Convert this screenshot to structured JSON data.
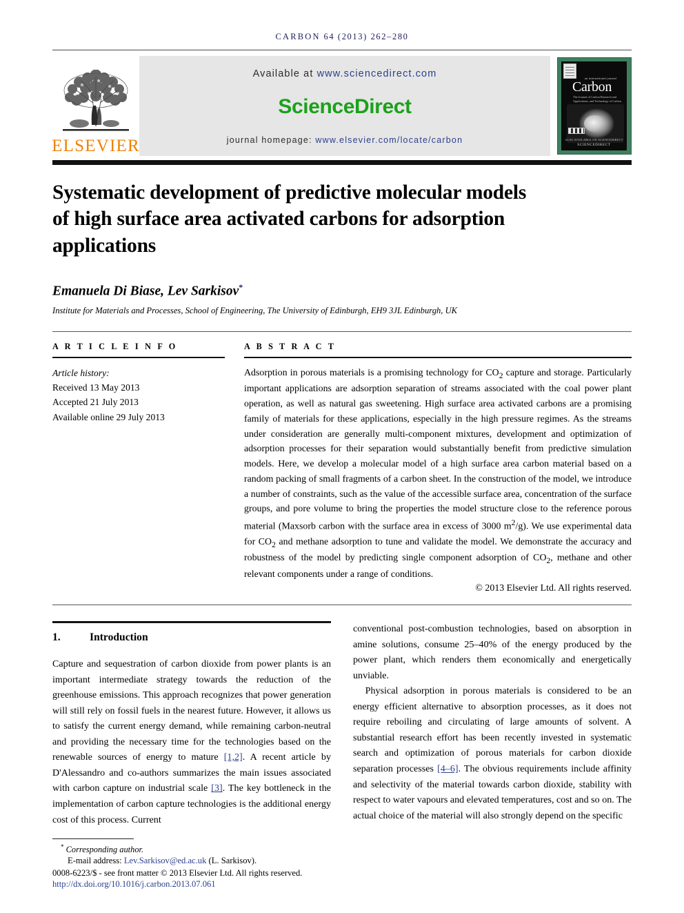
{
  "running_head": {
    "journal": "CARBON",
    "citation": "64 (2013) 262–280"
  },
  "masthead": {
    "publisher_logo_text": "ELSEVIER",
    "available_prefix": "Available at ",
    "available_url": "www.sciencedirect.com",
    "sciencedirect_logo": "ScienceDirect",
    "homepage_prefix": "journal homepage: ",
    "homepage_url": "www.elsevier.com/locate/carbon",
    "cover": {
      "kicker": "an international journal",
      "title": "Carbon",
      "subtitle": "The Journal of Carbon Research and Applications, and Technology of Carbon as an Element and Material",
      "footer_line1": "ALSO AVAILABLE ON SCIENCEDIRECT",
      "footer_line2": "SCIENCEDIRECT"
    },
    "colors": {
      "elsevier_orange": "#F08000",
      "sciencedirect_green": "#1BA11B",
      "cover_green": "#3F7F5F",
      "link_blue": "#2B3F8C",
      "banner_gray": "#E6E6E6"
    }
  },
  "article": {
    "title": "Systematic development of predictive molecular models of high surface area activated carbons for adsorption applications",
    "authors": "Emanuela Di Biase, Lev Sarkisov",
    "corresponding_marker": "*",
    "affiliation": "Institute for Materials and Processes, School of Engineering, The University of Edinburgh, EH9 3JL Edinburgh, UK"
  },
  "article_info": {
    "heading": "A R T I C L E   I N F O",
    "history_label": "Article history:",
    "received": "Received 13 May 2013",
    "accepted": "Accepted 21 July 2013",
    "available_online": "Available online 29 July 2013"
  },
  "abstract": {
    "heading": "A B S T R A C T",
    "text": "Adsorption in porous materials is a promising technology for CO2 capture and storage. Particularly important applications are adsorption separation of streams associated with the coal power plant operation, as well as natural gas sweetening. High surface area activated carbons are a promising family of materials for these applications, especially in the high pressure regimes. As the streams under consideration are generally multi-component mixtures, development and optimization of adsorption processes for their separation would substantially benefit from predictive simulation models. Here, we develop a molecular model of a high surface area carbon material based on a random packing of small fragments of a carbon sheet. In the construction of the model, we introduce a number of constraints, such as the value of the accessible surface area, concentration of the surface groups, and pore volume to bring the properties the model structure close to the reference porous material (Maxsorb carbon with the surface area in excess of 3000 m2/g). We use experimental data for CO2 and methane adsorption to tune and validate the model. We demonstrate the accuracy and robustness of the model by predicting single component adsorption of CO2, methane and other relevant components under a range of conditions.",
    "copyright": "© 2013 Elsevier Ltd. All rights reserved."
  },
  "section": {
    "number": "1.",
    "title": "Introduction"
  },
  "body": {
    "left_para_1_a": "Capture and sequestration of carbon dioxide from power plants is an important intermediate strategy towards the reduction of the greenhouse emissions. This approach recognizes that power generation will still rely on fossil fuels in the nearest future. However, it allows us to satisfy the current energy demand, while remaining carbon-neutral and providing the necessary time for the technologies based on the renewable sources of energy to mature ",
    "left_cite_1": "[1,2]",
    "left_para_1_b": ". A recent article by D'Alessandro and co-authors summarizes the main issues associated with carbon capture on industrial scale ",
    "left_cite_2": "[3]",
    "left_para_1_c": ". The key bottleneck in the implementation of carbon capture technologies is the additional energy cost of this process. Current",
    "right_para_1": "conventional post-combustion technologies, based on absorption in amine solutions, consume 25–40% of the energy produced by the power plant, which renders them economically and energetically unviable.",
    "right_para_2_a": "Physical adsorption in porous materials is considered to be an energy efficient alternative to absorption processes, as it does not require reboiling and circulating of large amounts of solvent. A substantial research effort has been recently invested in systematic search and optimization of porous materials for carbon dioxide separation processes ",
    "right_cite_1": "[4–6]",
    "right_para_2_b": ". The obvious requirements include affinity and selectivity of the material towards carbon dioxide, stability with respect to water vapours and elevated temperatures, cost and so on. The actual choice of the material will also strongly depend on the specific"
  },
  "footer": {
    "corresponding_marker": "*",
    "corresponding_label": "Corresponding author.",
    "email_label": "E-mail address: ",
    "email": "Lev.Sarkisov@ed.ac.uk",
    "email_suffix": " (L. Sarkisov).",
    "issn_line": "0008-6223/$ - see front matter © 2013 Elsevier Ltd. All rights reserved.",
    "doi": "http://dx.doi.org/10.1016/j.carbon.2013.07.061"
  }
}
